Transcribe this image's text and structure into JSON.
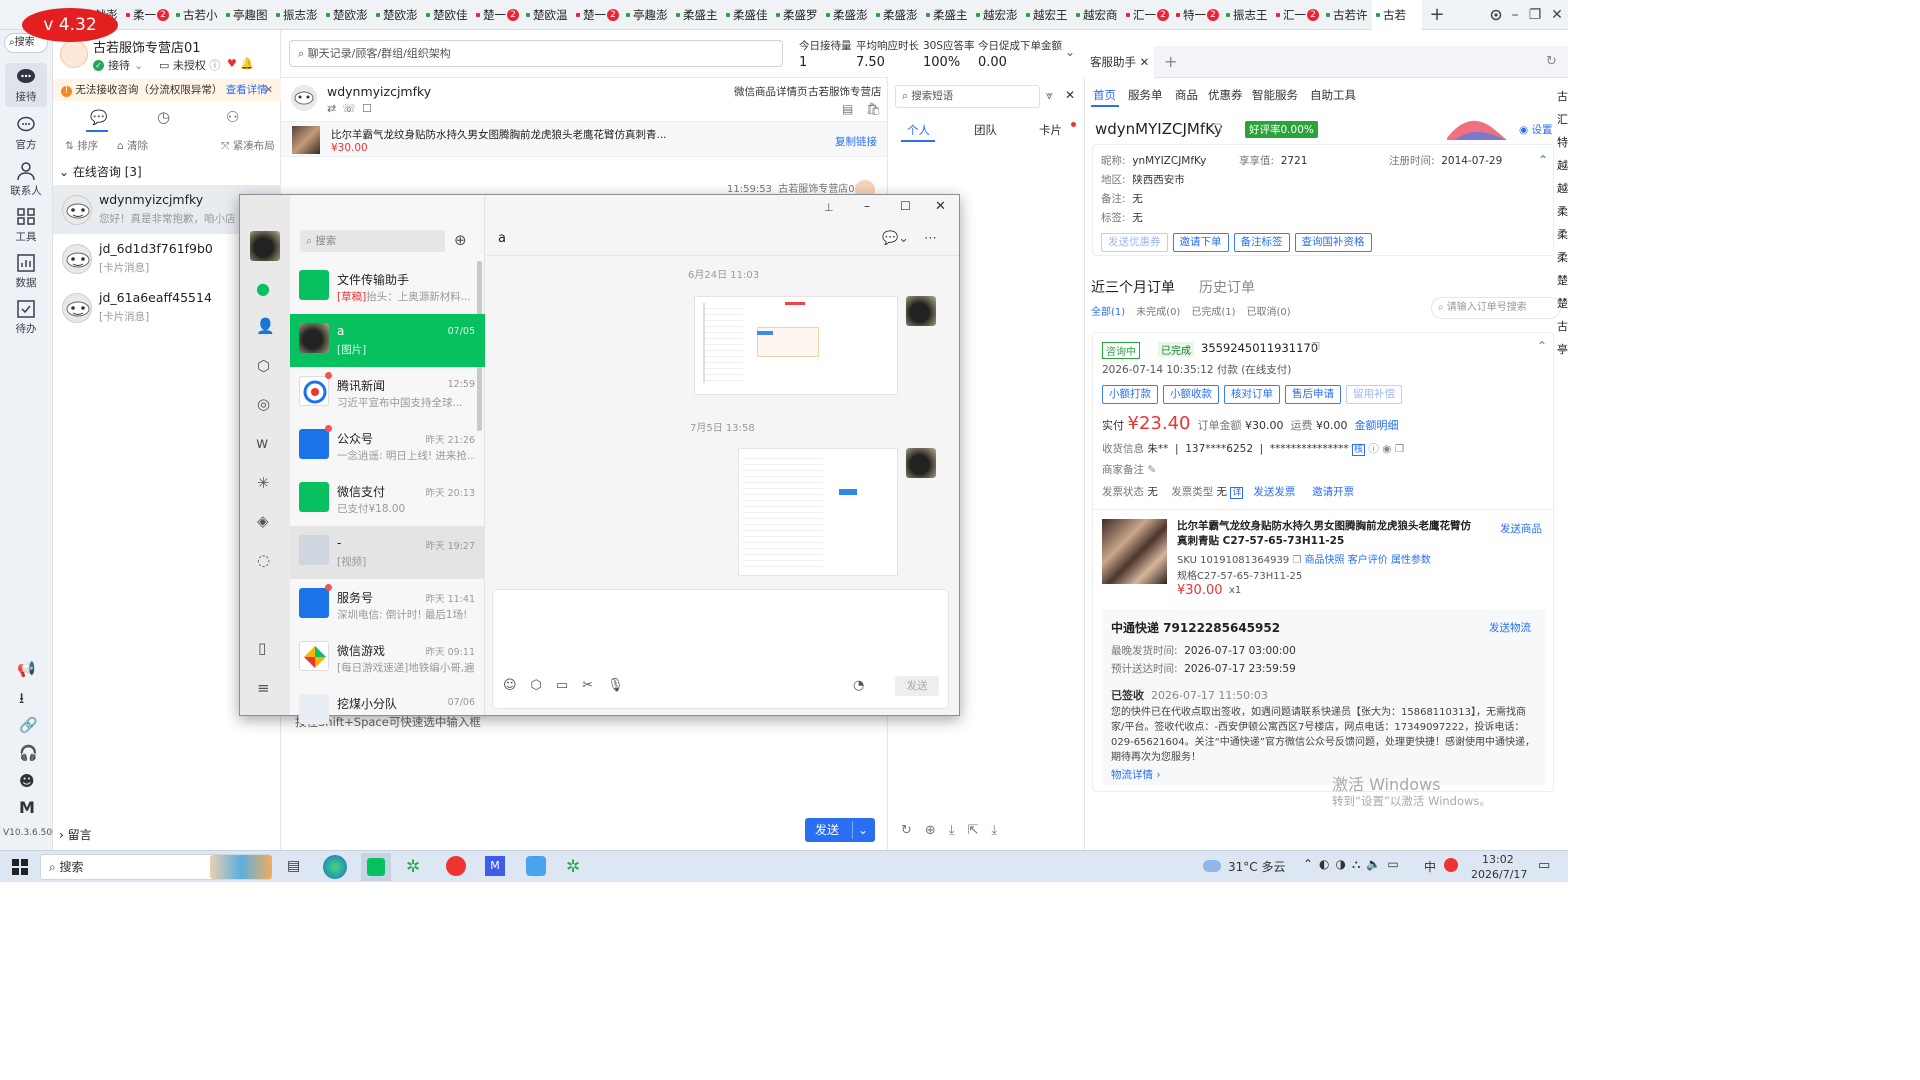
{
  "version_badge": "v 4.32",
  "tabs": [
    {
      "label": "款就澎",
      "dot": "g",
      "badge": ""
    },
    {
      "label": "柔一",
      "dot": "r",
      "badge": "2"
    },
    {
      "label": "古若小",
      "dot": "g",
      "badge": ""
    },
    {
      "label": "亭趣图",
      "dot": "g",
      "badge": ""
    },
    {
      "label": "振志澎",
      "dot": "g",
      "badge": ""
    },
    {
      "label": "楚欧澎",
      "dot": "g",
      "badge": ""
    },
    {
      "label": "楚欧澎",
      "dot": "g",
      "badge": ""
    },
    {
      "label": "楚欧佳",
      "dot": "g",
      "badge": ""
    },
    {
      "label": "楚一",
      "dot": "r",
      "badge": "2"
    },
    {
      "label": "楚欧温",
      "dot": "g",
      "badge": ""
    },
    {
      "label": "楚一",
      "dot": "r",
      "badge": "2"
    },
    {
      "label": "亭趣澎",
      "dot": "g",
      "badge": ""
    },
    {
      "label": "柔盛主",
      "dot": "g",
      "badge": ""
    },
    {
      "label": "柔盛佳",
      "dot": "g",
      "badge": ""
    },
    {
      "label": "柔盛罗",
      "dot": "g",
      "badge": ""
    },
    {
      "label": "柔盛澎",
      "dot": "g",
      "badge": ""
    },
    {
      "label": "柔盛澎",
      "dot": "g",
      "badge": ""
    },
    {
      "label": "柔盛主",
      "dot": "g",
      "badge": ""
    },
    {
      "label": "越宏澎",
      "dot": "g",
      "badge": ""
    },
    {
      "label": "越宏王",
      "dot": "g",
      "badge": ""
    },
    {
      "label": "越宏商",
      "dot": "g",
      "badge": ""
    },
    {
      "label": "汇一",
      "dot": "r",
      "badge": "2"
    },
    {
      "label": "特一",
      "dot": "r",
      "badge": "2"
    },
    {
      "label": "振志王",
      "dot": "g",
      "badge": ""
    },
    {
      "label": "汇一",
      "dot": "r",
      "badge": "2"
    },
    {
      "label": "古若许",
      "dot": "g",
      "badge": ""
    },
    {
      "label": "古若",
      "dot": "g",
      "badge": ""
    }
  ],
  "nav": {
    "search": "搜索",
    "items": [
      "接待",
      "官方",
      "联系人",
      "工具",
      "数据",
      "待办"
    ],
    "version": "V10.3.6.500",
    "m_label": "M"
  },
  "shop": {
    "name": "古若服饰专营店01",
    "status": "接待",
    "auth": "未授权",
    "warning": "无法接收咨询（分流权限异常）",
    "warning_link": "查看详情",
    "sort": "排序",
    "clear": "清除",
    "layout": "紧凑布局",
    "online_label": "在线咨询 [3]",
    "leave_msg": "留言"
  },
  "conversations": [
    {
      "name": "wdynmyizcjmfky",
      "msg": "您好！真是非常抱歉，咱小店"
    },
    {
      "name": "jd_6d1d3f761f9b0",
      "msg": "[卡片消息]"
    },
    {
      "name": "jd_61a6eaff45514",
      "msg": "[卡片消息]"
    }
  ],
  "center": {
    "search_placeholder": "聊天记录/顾客/群组/组织架构",
    "stats": [
      {
        "label": "今日接待量",
        "value": "1"
      },
      {
        "label": "平均响应时长",
        "value": "7.50"
      },
      {
        "label": "30S应答率",
        "value": "100%"
      },
      {
        "label": "今日促成下单金额",
        "value": "0.00"
      }
    ],
    "chat_user": "wdynmyizcjmfky",
    "wx_product_page": "微信商品详情页",
    "shop_name": "古若服饰专营店",
    "product_title": "比尔羊霸气龙纹身贴防水持久男女图腾胸前龙虎狼头老鹰花臂仿真刺青...",
    "product_price": "¥30.00",
    "copy_link": "复制链接",
    "msg_time": "11:59:53",
    "msg_sender": "古若服饰专营店01",
    "input_hint": "按住Shift+Space可快速选中输入框",
    "send": "发送",
    "phrase_search": "搜索短语",
    "phrase_tabs": [
      "个人",
      "团队",
      "卡片"
    ]
  },
  "wechat": {
    "search": "搜索",
    "chat_title": "a",
    "date1": "6月24日 11:03",
    "date2": "7月5日 13:58",
    "send": "发送",
    "contacts": [
      {
        "name": "文件传输助手",
        "time": "",
        "draft": "[草稿]",
        "msg": "抬头：上奥源新材料...",
        "icon": "file"
      },
      {
        "name": "a",
        "time": "07/05",
        "draft": "",
        "msg": "[图片]",
        "icon": "avatar"
      },
      {
        "name": "腾讯新闻",
        "time": "12:59",
        "draft": "",
        "msg": "习近平宣布中国支持全球...",
        "icon": "news"
      },
      {
        "name": "公众号",
        "time": "昨天 21:26",
        "draft": "",
        "msg": "一念逍遥: 明日上线! 进来抢...",
        "icon": "oa"
      },
      {
        "name": "微信支付",
        "time": "昨天 20:13",
        "draft": "",
        "msg": "已支付¥18.00",
        "icon": "pay"
      },
      {
        "name": "-",
        "time": "昨天 19:27",
        "draft": "",
        "msg": "[视频]",
        "icon": "person"
      },
      {
        "name": "服务号",
        "time": "昨天 11:41",
        "draft": "",
        "msg": "深圳电信: 倒计时! 最后1场!",
        "icon": "svc"
      },
      {
        "name": "微信游戏",
        "time": "昨天 09:11",
        "draft": "",
        "msg": "[每日游戏速递]地铁编小哥,遍...",
        "icon": "game"
      },
      {
        "name": "挖煤小分队",
        "time": "07/06",
        "draft": "",
        "msg": "",
        "icon": "group"
      }
    ]
  },
  "right": {
    "tab": "客服助手",
    "menu": [
      "首页",
      "服务单",
      "商品",
      "优惠券",
      "智能服务",
      "自助工具"
    ],
    "user": "wdynMYIZCJMfKy",
    "rating": "好评率0.00%",
    "settings": "设置",
    "nick_label": "昵称:",
    "nick": "ynMYIZCJMfKy",
    "jx_label": "享享值:",
    "jx": "2721",
    "reg_label": "注册时间:",
    "reg": "2014-07-29",
    "area_label": "地区:",
    "area": "陕西西安市",
    "note_label": "备注:",
    "note": "无",
    "tag_label": "标签:",
    "tag": "无",
    "actions": [
      "发送优惠券",
      "邀请下单",
      "备注标签",
      "查询国补资格"
    ],
    "orders_tab1": "近三个月订单",
    "orders_tab2": "历史订单",
    "filters": [
      "全部(1)",
      "未完成(0)",
      "已完成(1)",
      "已取消(0)"
    ],
    "order_search": "请输入订单号搜索",
    "consulting": "咨询中",
    "done": "已完成",
    "order_no": "3559245011931170",
    "pay_time": "2026-07-14 10:35:12 付款 (在线支付)",
    "order_btns": [
      "小额打款",
      "小额收款",
      "核对订单",
      "售后申请",
      "留用补偿"
    ],
    "paid_label": "实付",
    "paid": "¥23.40",
    "amount_label": "订单金额",
    "amount": "¥30.00",
    "freight_label": "运费",
    "freight": "¥0.00",
    "detail_link": "金额明细",
    "recv_label": "收货信息",
    "recv_name": "朱**",
    "recv_phone": "137****6252",
    "recv_addr": "***************",
    "merchant_note": "商家备注",
    "invoice_status_label": "发票状态",
    "invoice_status": "无",
    "invoice_type_label": "发票类型",
    "invoice_type": "无",
    "invoice_send": "发送发票",
    "invoice_invite": "邀请开票",
    "product_title": "比尔羊霸气龙纹身贴防水持久男女图腾胸前龙虎狼头老鹰花臂仿真刺青贴 C27-57-65-73H11-25",
    "send_product": "发送商品",
    "sku": "SKU 10191081364939",
    "snapshot": "商品快照",
    "review": "客户评价",
    "params": "属性参数",
    "spec": "规格C27-57-65-73H11-25",
    "product_price": "¥30.00",
    "qty": "x1",
    "express": "中通快递 79122285645952",
    "send_logistics": "发送物流",
    "ship_label": "最晚发货时间:",
    "ship": "2026-07-17 03:00:00",
    "arrive_label": "预计送达时间:",
    "arrive": "2026-07-17 23:59:59",
    "signed": "已签收",
    "signed_time": "2026-07-17 11:50:03",
    "signed_text": "您的快件已在代收点取出签收，如遇问题请联系快递员【张大为：15868110313】，无需找商家/平台。签收代收点：-西安伊顿公寓西区7号楼店，网点电话：17349097222，投诉电话：029-65621604。关注“中通快递”官方微信公众号反馈问题，处理更快捷！感谢使用中通快递，期待再次为您服务！",
    "logistics_link": "物流详情",
    "activate1": "激活 Windows",
    "activate2": "转到“设置”以激活 Windows。",
    "edge_chars": [
      "古",
      "汇",
      "特",
      "越",
      "越",
      "柔",
      "柔",
      "柔",
      "楚",
      "楚",
      "古",
      "亭"
    ]
  },
  "taskbar": {
    "search": "搜索",
    "weather": "31°C 多云",
    "ime": "中",
    "time": "13:02",
    "date": "2026/7/17"
  }
}
